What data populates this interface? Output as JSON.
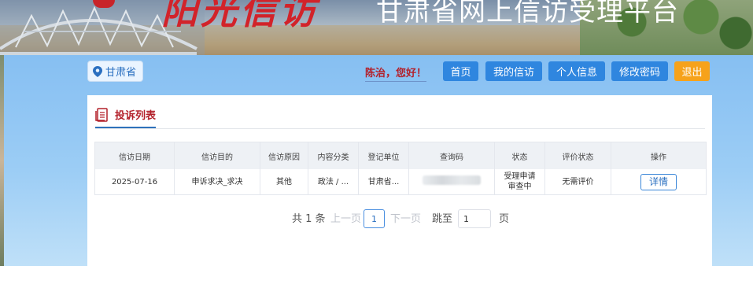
{
  "banner": {
    "calligraphy": "阳光信访",
    "title": "甘肃省网上信访受理平台"
  },
  "location": {
    "label": "甘肃省",
    "icon": "map-pin-icon"
  },
  "greeting": "陈治，您好！",
  "nav": {
    "home": "首页",
    "my_petitions": "我的信访",
    "profile": "个人信息",
    "change_password": "修改密码",
    "logout": "退出"
  },
  "panel": {
    "tab_title": "投诉列表",
    "tab_icon": "document-list-icon"
  },
  "table": {
    "headers": [
      "信访日期",
      "信访目的",
      "信访原因",
      "内容分类",
      "登记单位",
      "查询码",
      "状态",
      "评价状态",
      "操作"
    ],
    "rows": [
      {
        "date": "2025-07-16",
        "purpose": "申诉求决_求决",
        "reason": "其他",
        "category": "政法 / ...",
        "unit": "甘肃省...",
        "query_code": "",
        "status_line1": "受理申请",
        "status_line2": "审查中",
        "evaluation": "无需评价",
        "action": "详情"
      }
    ]
  },
  "pagination": {
    "total": "共 1 条",
    "prev": "上一页",
    "current_page": "1",
    "next": "下一页",
    "jump_label": "跳至",
    "jump_value": "1",
    "page_unit": "页"
  },
  "colors": {
    "primary": "#2f86df",
    "logout": "#f6a21b",
    "accent_red": "#b3202a",
    "sky": "#86bff2"
  }
}
